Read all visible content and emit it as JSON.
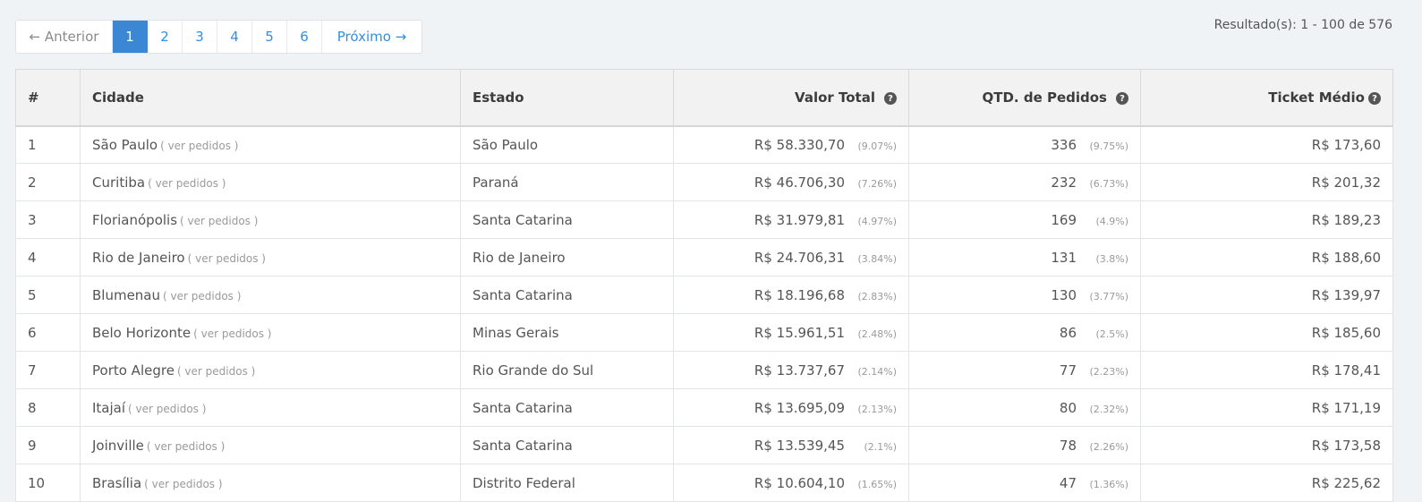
{
  "pagination": {
    "prev_label": "← Anterior",
    "pages": [
      "1",
      "2",
      "3",
      "4",
      "5",
      "6"
    ],
    "active_page": "1",
    "next_label": "Próximo →"
  },
  "result_count": "Resultado(s): 1 - 100 de 576",
  "table": {
    "headers": {
      "index": "#",
      "city": "Cidade",
      "state": "Estado",
      "total": "Valor Total",
      "orders": "QTD. de Pedidos",
      "ticket": "Ticket Médio"
    },
    "help_icon": "?",
    "link_label": "( ver pedidos )",
    "rows": [
      {
        "n": "1",
        "city": "São Paulo",
        "state": "São Paulo",
        "total": "R$ 58.330,70",
        "total_pct": "(9.07%)",
        "orders": "336",
        "orders_pct": "(9.75%)",
        "ticket": "R$ 173,60"
      },
      {
        "n": "2",
        "city": "Curitiba",
        "state": "Paraná",
        "total": "R$ 46.706,30",
        "total_pct": "(7.26%)",
        "orders": "232",
        "orders_pct": "(6.73%)",
        "ticket": "R$ 201,32"
      },
      {
        "n": "3",
        "city": "Florianópolis",
        "state": "Santa Catarina",
        "total": "R$ 31.979,81",
        "total_pct": "(4.97%)",
        "orders": "169",
        "orders_pct": "(4.9%)",
        "ticket": "R$ 189,23"
      },
      {
        "n": "4",
        "city": "Rio de Janeiro",
        "state": "Rio de Janeiro",
        "total": "R$ 24.706,31",
        "total_pct": "(3.84%)",
        "orders": "131",
        "orders_pct": "(3.8%)",
        "ticket": "R$ 188,60"
      },
      {
        "n": "5",
        "city": "Blumenau",
        "state": "Santa Catarina",
        "total": "R$ 18.196,68",
        "total_pct": "(2.83%)",
        "orders": "130",
        "orders_pct": "(3.77%)",
        "ticket": "R$ 139,97"
      },
      {
        "n": "6",
        "city": "Belo Horizonte",
        "state": "Minas Gerais",
        "total": "R$ 15.961,51",
        "total_pct": "(2.48%)",
        "orders": "86",
        "orders_pct": "(2.5%)",
        "ticket": "R$ 185,60"
      },
      {
        "n": "7",
        "city": "Porto Alegre",
        "state": "Rio Grande do Sul",
        "total": "R$ 13.737,67",
        "total_pct": "(2.14%)",
        "orders": "77",
        "orders_pct": "(2.23%)",
        "ticket": "R$ 178,41"
      },
      {
        "n": "8",
        "city": "Itajaí",
        "state": "Santa Catarina",
        "total": "R$ 13.695,09",
        "total_pct": "(2.13%)",
        "orders": "80",
        "orders_pct": "(2.32%)",
        "ticket": "R$ 171,19"
      },
      {
        "n": "9",
        "city": "Joinville",
        "state": "Santa Catarina",
        "total": "R$ 13.539,45",
        "total_pct": "(2.1%)",
        "orders": "78",
        "orders_pct": "(2.26%)",
        "ticket": "R$ 173,58"
      },
      {
        "n": "10",
        "city": "Brasília",
        "state": "Distrito Federal",
        "total": "R$ 10.604,10",
        "total_pct": "(1.65%)",
        "orders": "47",
        "orders_pct": "(1.36%)",
        "ticket": "R$ 225,62"
      }
    ]
  }
}
